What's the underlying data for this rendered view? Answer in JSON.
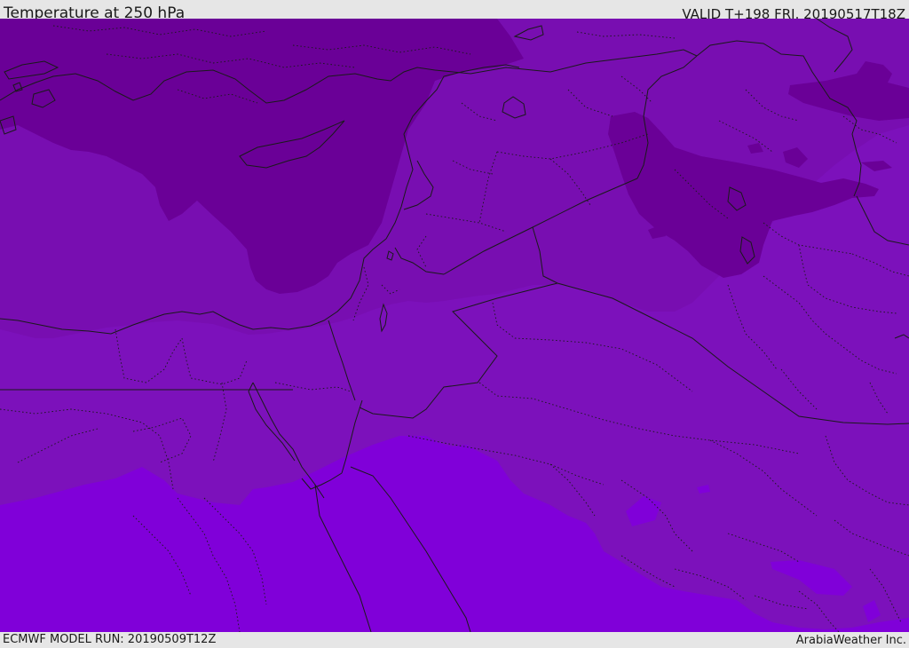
{
  "header": {
    "title": "Temperature at 250 hPa",
    "valid_time": "VALID T+198 FRI. 20190517T18Z"
  },
  "footer": {
    "model_run": "ECMWF MODEL RUN: 20190509T12Z",
    "credit": "ArabiaWeather Inc."
  },
  "map": {
    "colors": {
      "coldest_band": "#6a0097",
      "cold_band": "#780eb1",
      "mid_band": "#7c11bb",
      "warm_band": "#8000d9",
      "borders": "#1a1a1a"
    }
  }
}
